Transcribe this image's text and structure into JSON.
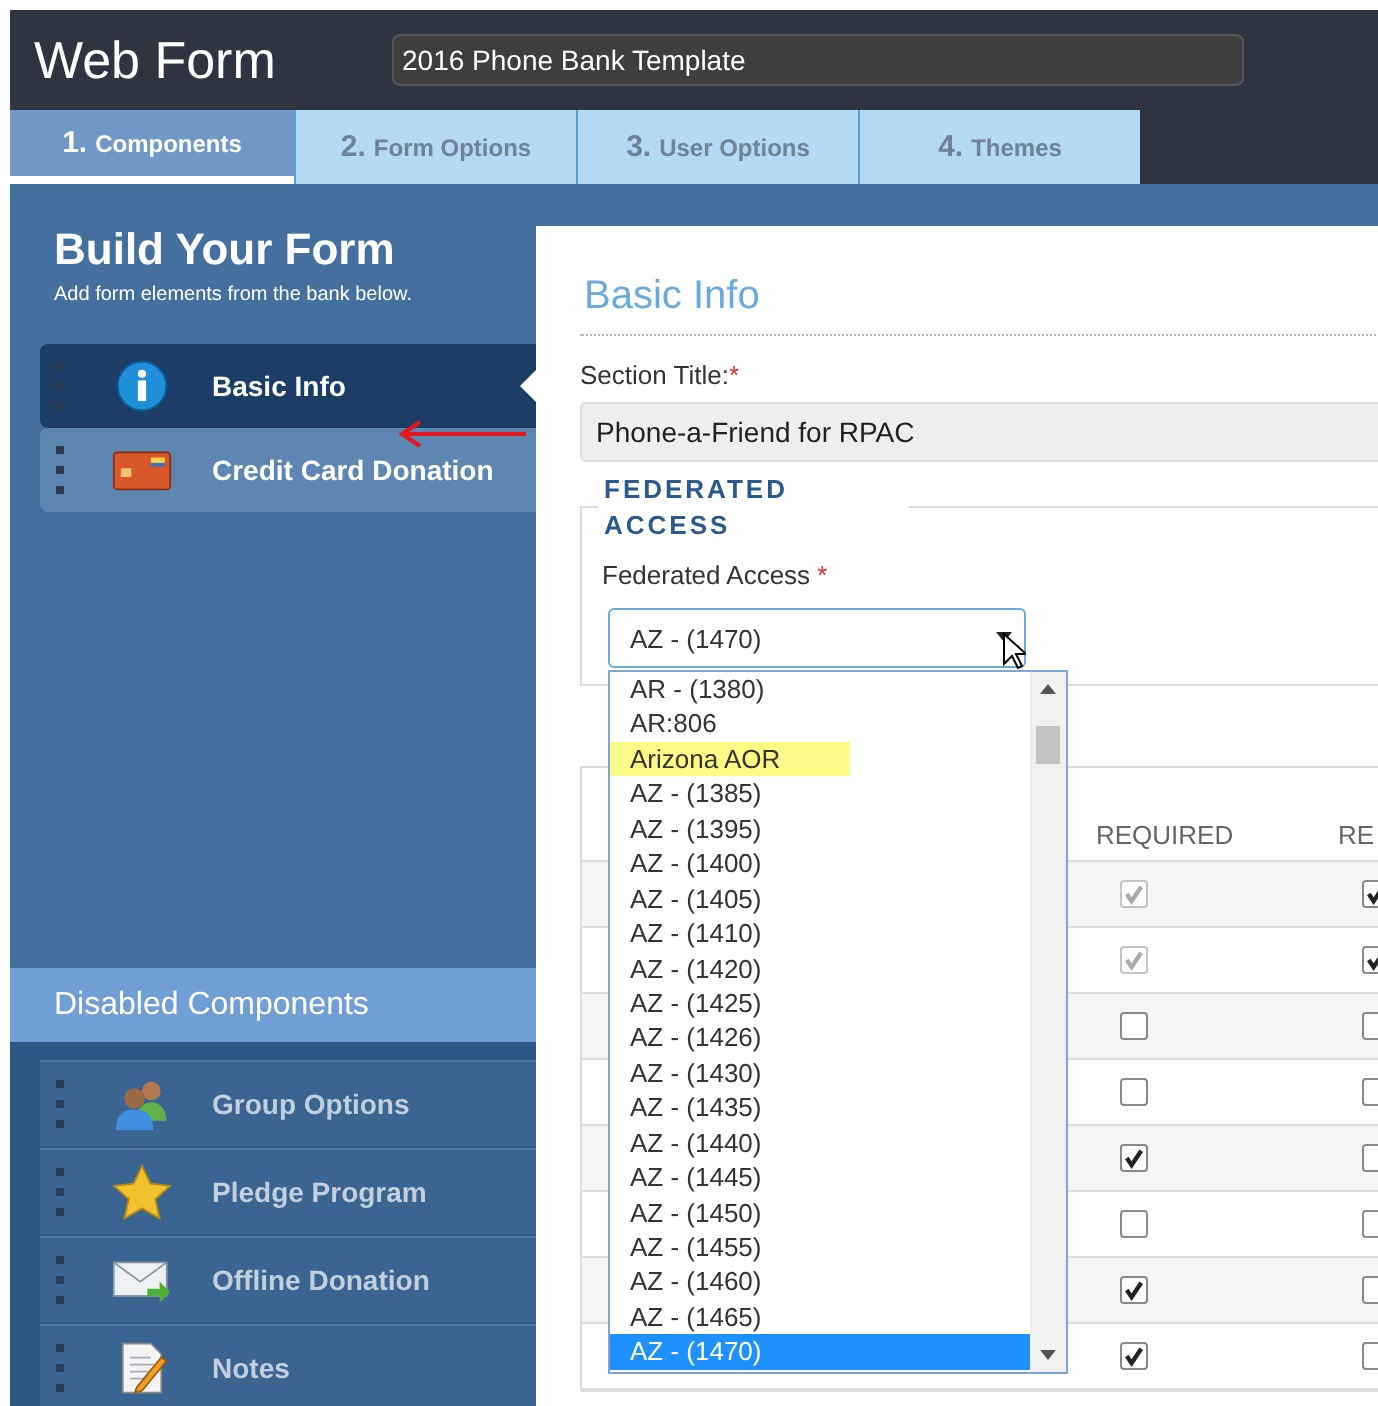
{
  "header": {
    "title": "Web Form",
    "form_name": "2016 Phone Bank Template"
  },
  "tabs": [
    {
      "number": "1.",
      "label": "Components",
      "selected": true
    },
    {
      "number": "2.",
      "label": "Form Options",
      "selected": false
    },
    {
      "number": "3.",
      "label": "User Options",
      "selected": false
    },
    {
      "number": "4.",
      "label": "Themes",
      "selected": false
    }
  ],
  "sidebar": {
    "title": "Build Your Form",
    "subtitle": "Add form elements from the bank below.",
    "components": [
      {
        "label": "Basic Info",
        "kind": "info",
        "selected": true
      },
      {
        "label": "Credit Card Donation",
        "kind": "card",
        "selected": false
      }
    ],
    "disabled_title": "Disabled Components",
    "disabled_components": [
      {
        "label": "Group Options",
        "kind": "people"
      },
      {
        "label": "Pledge Program",
        "kind": "star"
      },
      {
        "label": "Offline Donation",
        "kind": "envelope"
      },
      {
        "label": "Notes",
        "kind": "notes"
      }
    ]
  },
  "section": {
    "heading": "Basic Info",
    "title_label": "Section Title:",
    "required_mark": "*",
    "title_value": "Phone-a-Friend for RPAC",
    "fieldset_legend": "FEDERATED ACCESS",
    "access_label": "Federated Access",
    "access_value": "AZ - (1470)",
    "options": [
      {
        "label": "AR - (1380)",
        "highlighted": false,
        "selected": false
      },
      {
        "label": "AR:806",
        "highlighted": false,
        "selected": false
      },
      {
        "label": "Arizona AOR",
        "highlighted": true,
        "selected": false
      },
      {
        "label": "AZ - (1385)",
        "highlighted": false,
        "selected": false
      },
      {
        "label": "AZ - (1395)",
        "highlighted": false,
        "selected": false
      },
      {
        "label": "AZ - (1400)",
        "highlighted": false,
        "selected": false
      },
      {
        "label": "AZ - (1405)",
        "highlighted": false,
        "selected": false
      },
      {
        "label": "AZ - (1410)",
        "highlighted": false,
        "selected": false
      },
      {
        "label": "AZ - (1420)",
        "highlighted": false,
        "selected": false
      },
      {
        "label": "AZ - (1425)",
        "highlighted": false,
        "selected": false
      },
      {
        "label": "AZ - (1426)",
        "highlighted": false,
        "selected": false
      },
      {
        "label": "AZ - (1430)",
        "highlighted": false,
        "selected": false
      },
      {
        "label": "AZ - (1435)",
        "highlighted": false,
        "selected": false
      },
      {
        "label": "AZ - (1440)",
        "highlighted": false,
        "selected": false
      },
      {
        "label": "AZ - (1445)",
        "highlighted": false,
        "selected": false
      },
      {
        "label": "AZ - (1450)",
        "highlighted": false,
        "selected": false
      },
      {
        "label": "AZ - (1455)",
        "highlighted": false,
        "selected": false
      },
      {
        "label": "AZ - (1460)",
        "highlighted": false,
        "selected": false
      },
      {
        "label": "AZ - (1465)",
        "highlighted": false,
        "selected": false
      },
      {
        "label": "AZ - (1470)",
        "highlighted": false,
        "selected": true
      }
    ]
  },
  "table": {
    "columns": [
      "REQUIRED",
      "RE"
    ],
    "rows": [
      {
        "required": true,
        "required_disabled": true,
        "column_2": true
      },
      {
        "required": true,
        "required_disabled": true,
        "column_2": true
      },
      {
        "required": false,
        "required_disabled": false,
        "column_2": false
      },
      {
        "required": false,
        "required_disabled": false,
        "column_2": false
      },
      {
        "required": true,
        "required_disabled": false,
        "column_2": false
      },
      {
        "required": false,
        "required_disabled": false,
        "column_2": false
      },
      {
        "required": true,
        "required_disabled": false,
        "column_2": false
      },
      {
        "required": true,
        "required_disabled": false,
        "column_2": false
      }
    ]
  }
}
